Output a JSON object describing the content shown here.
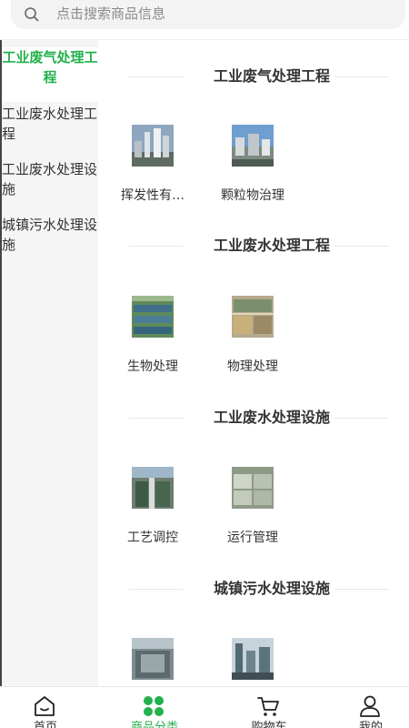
{
  "search": {
    "placeholder": "点击搜索商品信息"
  },
  "sidebar": {
    "items": [
      {
        "label": "工业废气处理工程"
      },
      {
        "label": "工业废水处理工程"
      },
      {
        "label": "工业废水处理设施"
      },
      {
        "label": "城镇污水处理设施"
      }
    ]
  },
  "sections": [
    {
      "title": "工业废气处理工程",
      "products": [
        {
          "name": "挥发性有…"
        },
        {
          "name": "颗粒物治理"
        }
      ]
    },
    {
      "title": "工业废水处理工程",
      "products": [
        {
          "name": "生物处理"
        },
        {
          "name": "物理处理"
        }
      ]
    },
    {
      "title": "工业废水处理设施",
      "products": [
        {
          "name": "工艺调控"
        },
        {
          "name": "运行管理"
        }
      ]
    },
    {
      "title": "城镇污水处理设施",
      "products": [
        {
          "name": ""
        },
        {
          "name": ""
        }
      ]
    }
  ],
  "tabbar": {
    "items": [
      {
        "label": "首页",
        "icon": "home-icon"
      },
      {
        "label": "商品分类",
        "icon": "category-icon"
      },
      {
        "label": "购物车",
        "icon": "cart-icon"
      },
      {
        "label": "我的",
        "icon": "user-icon"
      }
    ],
    "active_color": "#22b14c"
  }
}
